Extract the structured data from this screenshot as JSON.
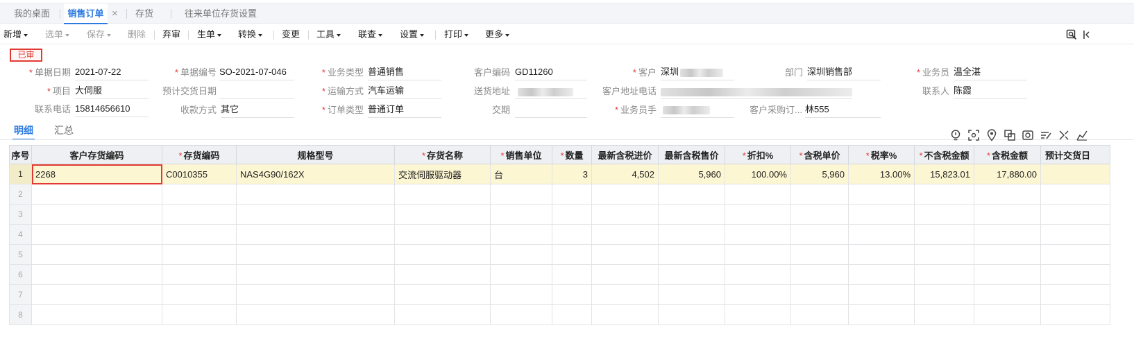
{
  "tabs": [
    {
      "label": "我的桌面"
    },
    {
      "label": "销售订单"
    },
    {
      "label": "存货"
    },
    {
      "label": "往来单位存货设置"
    }
  ],
  "tab_close": "×",
  "toolbar": {
    "items": [
      "新增",
      "选单",
      "保存",
      "删除",
      "弃审",
      "生单",
      "转换",
      "变更",
      "工具",
      "联查",
      "设置",
      "打印",
      "更多"
    ]
  },
  "status_stamp": "已审",
  "form": {
    "date": {
      "label": "单据日期",
      "value": "2021-07-22"
    },
    "order_no": {
      "label": "单据编号",
      "value": "SO-2021-07-046"
    },
    "biz_type": {
      "label": "业务类型",
      "value": "普通销售"
    },
    "customer_code": {
      "label": "客户编码",
      "value": "GD11260"
    },
    "customer": {
      "label": "客户",
      "value": "深圳"
    },
    "department": {
      "label": "部门",
      "value": "深圳销售部"
    },
    "salesman": {
      "label": "业务员",
      "value": "温全湛"
    },
    "project": {
      "label": "项目",
      "value": "大伺服"
    },
    "expected_delivery": {
      "label": "预计交货日期",
      "value": ""
    },
    "transport": {
      "label": "运输方式",
      "value": "汽车运输"
    },
    "delivery_address": {
      "label": "送货地址",
      "value": ""
    },
    "customer_contact": {
      "label": "客户地址电话",
      "value": ""
    },
    "contact_person": {
      "label": "联系人",
      "value": "陈霞"
    },
    "phone": {
      "label": "联系电话",
      "value": "15814656610"
    },
    "payment": {
      "label": "收款方式",
      "value": "其它"
    },
    "order_type": {
      "label": "订单类型",
      "value": "普通订单"
    },
    "due": {
      "label": "交期",
      "value": ""
    },
    "salesman_phone": {
      "label": "业务员手",
      "value": ""
    },
    "customer_po": {
      "label": "客户采购订...",
      "value": "林555"
    }
  },
  "subtabs": [
    "明细",
    "汇总"
  ],
  "grid": {
    "columns": [
      {
        "label": "序号",
        "required": false
      },
      {
        "label": "客户存货编码",
        "required": false
      },
      {
        "label": "存货编码",
        "required": true
      },
      {
        "label": "规格型号",
        "required": false
      },
      {
        "label": "存货名称",
        "required": true
      },
      {
        "label": "销售单位",
        "required": true
      },
      {
        "label": "数量",
        "required": true
      },
      {
        "label": "最新含税进价",
        "required": false
      },
      {
        "label": "最新含税售价",
        "required": false
      },
      {
        "label": "折扣%",
        "required": true
      },
      {
        "label": "含税单价",
        "required": true
      },
      {
        "label": "税率%",
        "required": true
      },
      {
        "label": "不含税金额",
        "required": true
      },
      {
        "label": "含税金额",
        "required": true
      },
      {
        "label": "预计交货日",
        "required": false
      }
    ],
    "rows": [
      {
        "no": "1",
        "cust_code": "2268",
        "inv_code": "C0010355",
        "spec": "NAS4G90/162X",
        "name": "交流伺服驱动器",
        "unit": "台",
        "qty": "3",
        "last_cost": "4,502",
        "last_price": "5,960",
        "discount": "100.00%",
        "unit_price": "5,960",
        "tax_rate": "13.00%",
        "net_amount": "15,823.01",
        "gross_amount": "17,880.00",
        "delivery": ""
      },
      {
        "no": "2"
      },
      {
        "no": "3"
      },
      {
        "no": "4"
      },
      {
        "no": "5"
      },
      {
        "no": "6"
      },
      {
        "no": "7"
      },
      {
        "no": "8"
      }
    ]
  }
}
